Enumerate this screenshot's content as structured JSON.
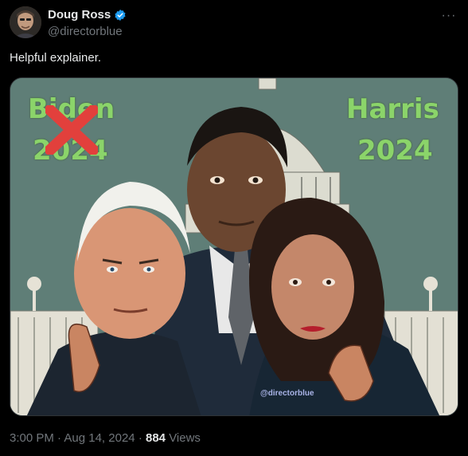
{
  "author": {
    "display_name": "Doug Ross",
    "handle": "@directorblue",
    "verified": true
  },
  "tweet": {
    "text": "Helpful explainer.",
    "more_label": "···"
  },
  "media": {
    "alt_icon": "poster-image",
    "left_name": "Biden",
    "left_year": "2024",
    "right_name": "Harris",
    "right_year": "2024",
    "watermark": "@directorblue",
    "colors": {
      "sky": "#5f7e77",
      "poster_text": "#8bd46a",
      "x_mark": "#e2403c"
    }
  },
  "meta": {
    "time": "3:00 PM",
    "separator": "·",
    "date": "Aug 14, 2024",
    "views_count": "884",
    "views_label": "Views"
  }
}
